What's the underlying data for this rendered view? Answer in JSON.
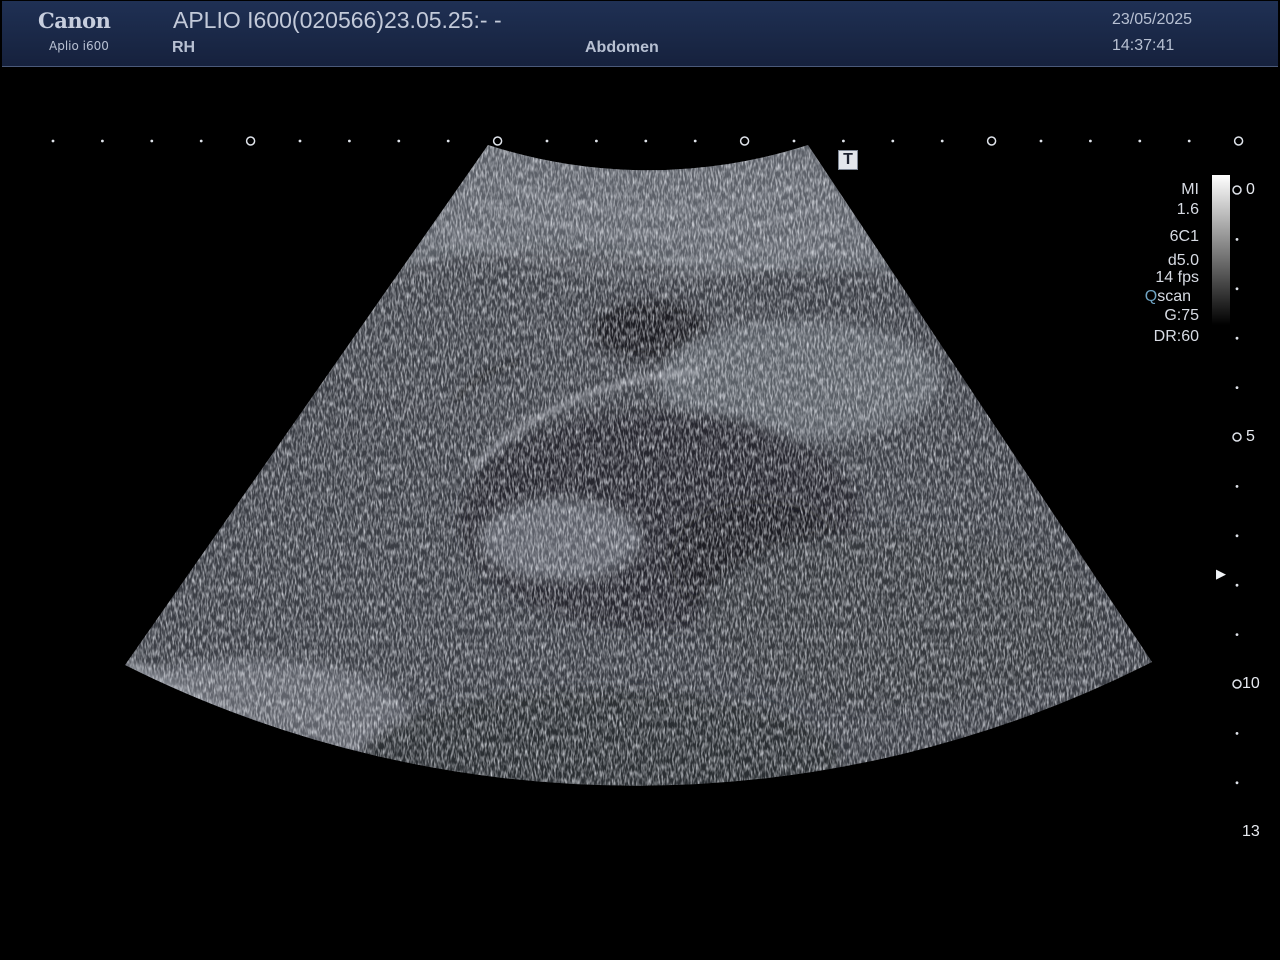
{
  "header": {
    "brand": "Canon",
    "model": "Aplio i600",
    "device_id": "APLIO I600(020566)23.05.25:- -",
    "side": "RH",
    "preset": "Abdomen",
    "date": "23/05/2025",
    "time": "14:37:41"
  },
  "params": {
    "mi_label": "MI",
    "mi_value": "1.6",
    "probe": "6C1",
    "depth": "d5.0",
    "frame_rate": "14 fps",
    "qscan_q": "Q",
    "qscan_rest": "scan",
    "gain": "G:75",
    "dynamic_range": "DR:60"
  },
  "depth_scale": {
    "labels": [
      "0",
      "5",
      "10",
      "13"
    ]
  },
  "markers": {
    "t_marker": "T"
  },
  "colors": {
    "header_bg": "#1a2847",
    "text": "#d7dbe3",
    "qscan_accent": "#6fa3c2",
    "background": "#000000"
  }
}
